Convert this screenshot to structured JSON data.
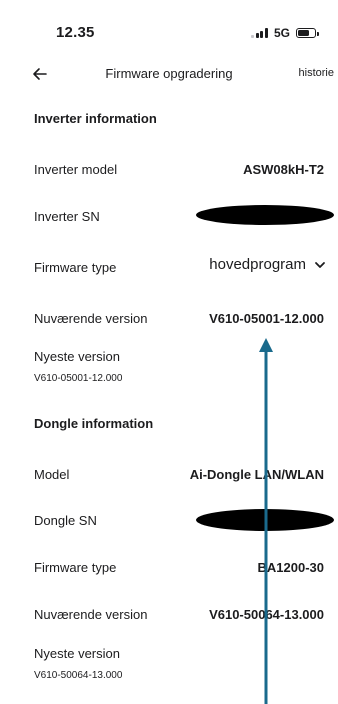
{
  "status_bar": {
    "time": "12.35",
    "network": "5G",
    "battery_level": 0.7,
    "signal_bars_active": 3,
    "signal_bars_total": 4
  },
  "nav": {
    "back_icon": "arrow-left-icon",
    "title": "Firmware opgradering",
    "action": "historie"
  },
  "inverter": {
    "header": "Inverter information",
    "model_label": "Inverter model",
    "model_value": "ASW08kH-T2",
    "sn_label": "Inverter SN",
    "sn_visible": "0",
    "firmware_type_label": "Firmware type",
    "firmware_type_value": "hovedprogram",
    "current_version_label": "Nuværende version",
    "current_version_value": "V610-05001-12.000",
    "newest_version_label": "Nyeste version",
    "newest_version_value": "V610-05001-12.000"
  },
  "dongle": {
    "header": "Dongle information",
    "model_label": "Model",
    "model_value": "Ai-Dongle LAN/WLAN",
    "sn_label": "Dongle SN",
    "firmware_type_label": "Firmware type",
    "firmware_type_value": "BA1200-30",
    "current_version_label": "Nuværende version",
    "current_version_value": "V610-50064-13.000",
    "newest_version_label": "Nyeste version",
    "newest_version_value": "V610-50064-13.000"
  },
  "colors": {
    "annotation_arrow": "#1a6a8c",
    "redaction": "#000000"
  }
}
